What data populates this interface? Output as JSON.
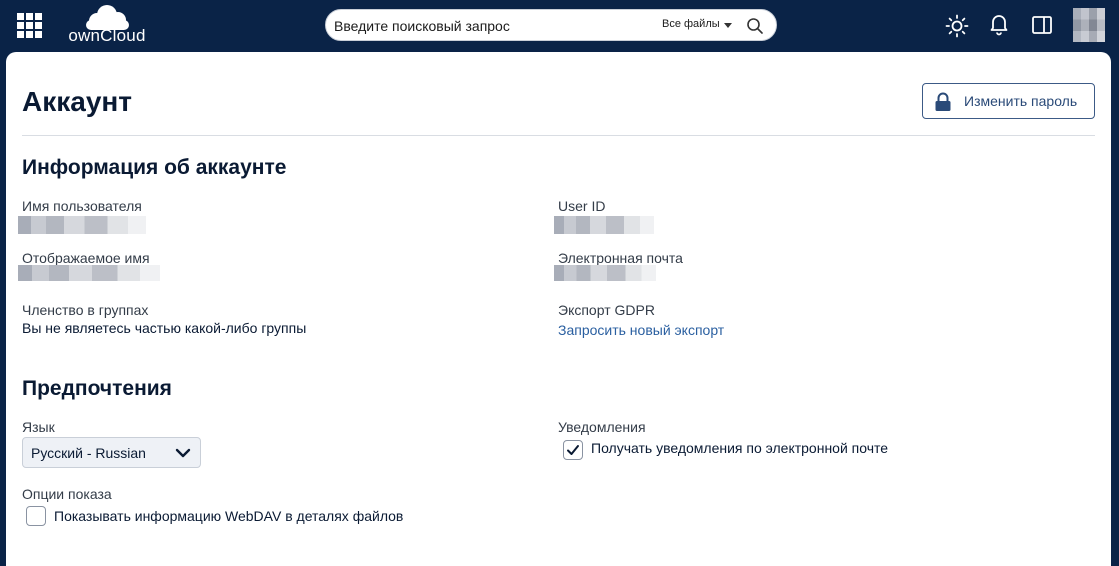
{
  "header": {
    "logo_text": "ownCloud",
    "search": {
      "placeholder": "Введите поисковый запрос",
      "scope_label": "Все файлы"
    }
  },
  "account": {
    "title": "Аккаунт",
    "change_password_label": "Изменить пароль"
  },
  "info": {
    "heading": "Информация об аккаунте",
    "username_label": "Имя пользователя",
    "display_name_label": "Отображаемое имя",
    "groups_label": "Членство в группах",
    "groups_value": "Вы не являетесь частью какой-либо группы",
    "user_id_label": "User ID",
    "email_label": "Электронная почта",
    "gdpr_label": "Экспорт GDPR",
    "gdpr_link": "Запросить новый экспорт"
  },
  "preferences": {
    "heading": "Предпочтения",
    "language_label": "Язык",
    "language_value": "Русский - Russian",
    "notifications_label": "Уведомления",
    "email_notifications_label": "Получать уведомления по электронной почте",
    "email_notifications_checked": true,
    "display_options_label": "Опции показа",
    "webdav_label": "Показывать информацию WebDAV в деталях файлов",
    "webdav_checked": false
  },
  "colors": {
    "topbar_bg": "#0a2347",
    "link": "#2a5fa0",
    "button_border": "#3c5a86"
  }
}
